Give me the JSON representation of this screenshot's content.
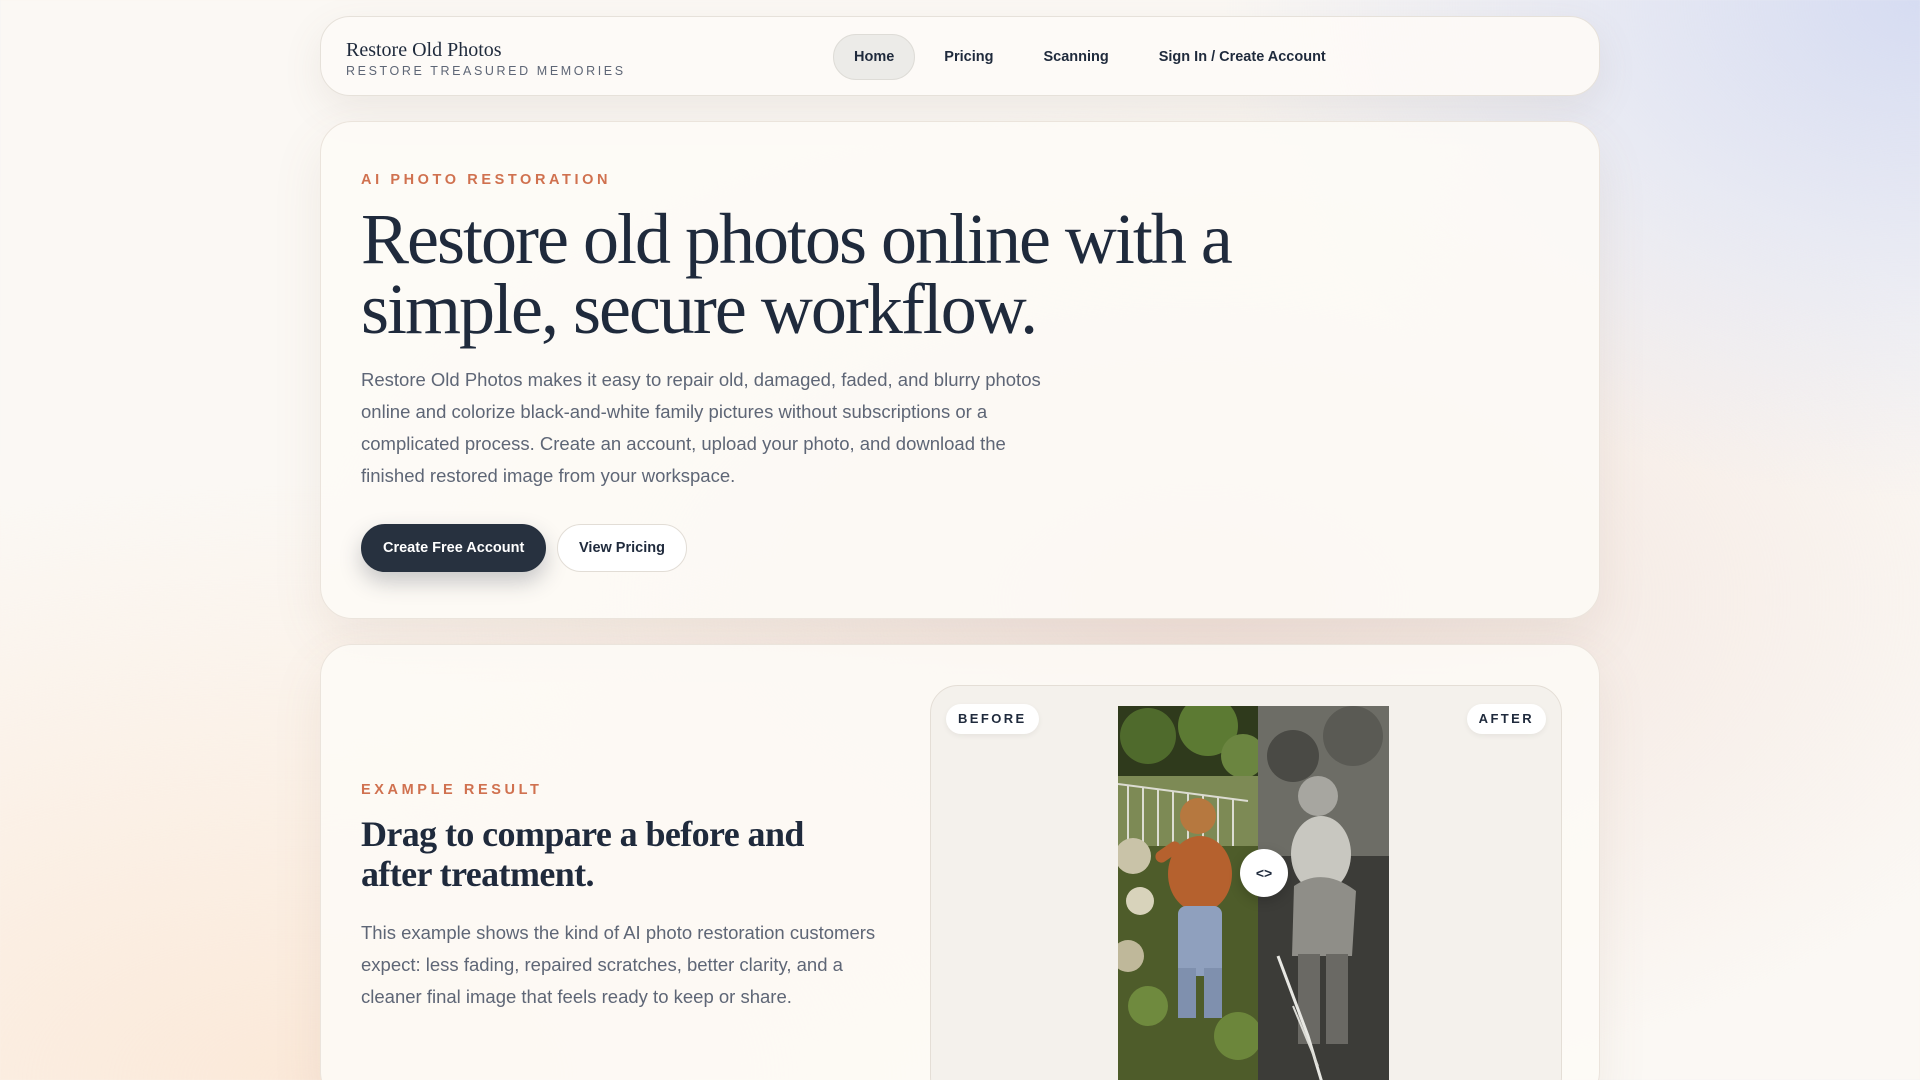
{
  "nav": {
    "brand_name": "Restore Old Photos",
    "brand_tagline": "RESTORE TREASURED MEMORIES",
    "links": [
      {
        "label": "Home",
        "active": true
      },
      {
        "label": "Pricing",
        "active": false
      },
      {
        "label": "Scanning",
        "active": false
      },
      {
        "label": "Sign In / Create Account",
        "active": false
      }
    ]
  },
  "hero": {
    "eyebrow": "AI PHOTO RESTORATION",
    "title": "Restore old photos online with a simple, secure workflow.",
    "description": "Restore Old Photos makes it easy to repair old, damaged, faded, and blurry photos online and colorize black-and-white family pictures without subscriptions or a complicated process. Create an account, upload your photo, and download the finished restored image from your workspace.",
    "primary_button": "Create Free Account",
    "secondary_button": "View Pricing"
  },
  "example": {
    "eyebrow": "EXAMPLE RESULT",
    "title": "Drag to compare a before and after treatment.",
    "description": "This example shows the kind of AI photo restoration customers expect: less fading, repaired scratches, better clarity, and a cleaner final image that feels ready to keep or share.",
    "before_label": "BEFORE",
    "after_label": "AFTER",
    "handle_label": "<>"
  },
  "colors": {
    "accent": "#d0714f",
    "primary_dark": "#27313f",
    "text": "#1f2a3c",
    "muted": "#5e6676"
  }
}
